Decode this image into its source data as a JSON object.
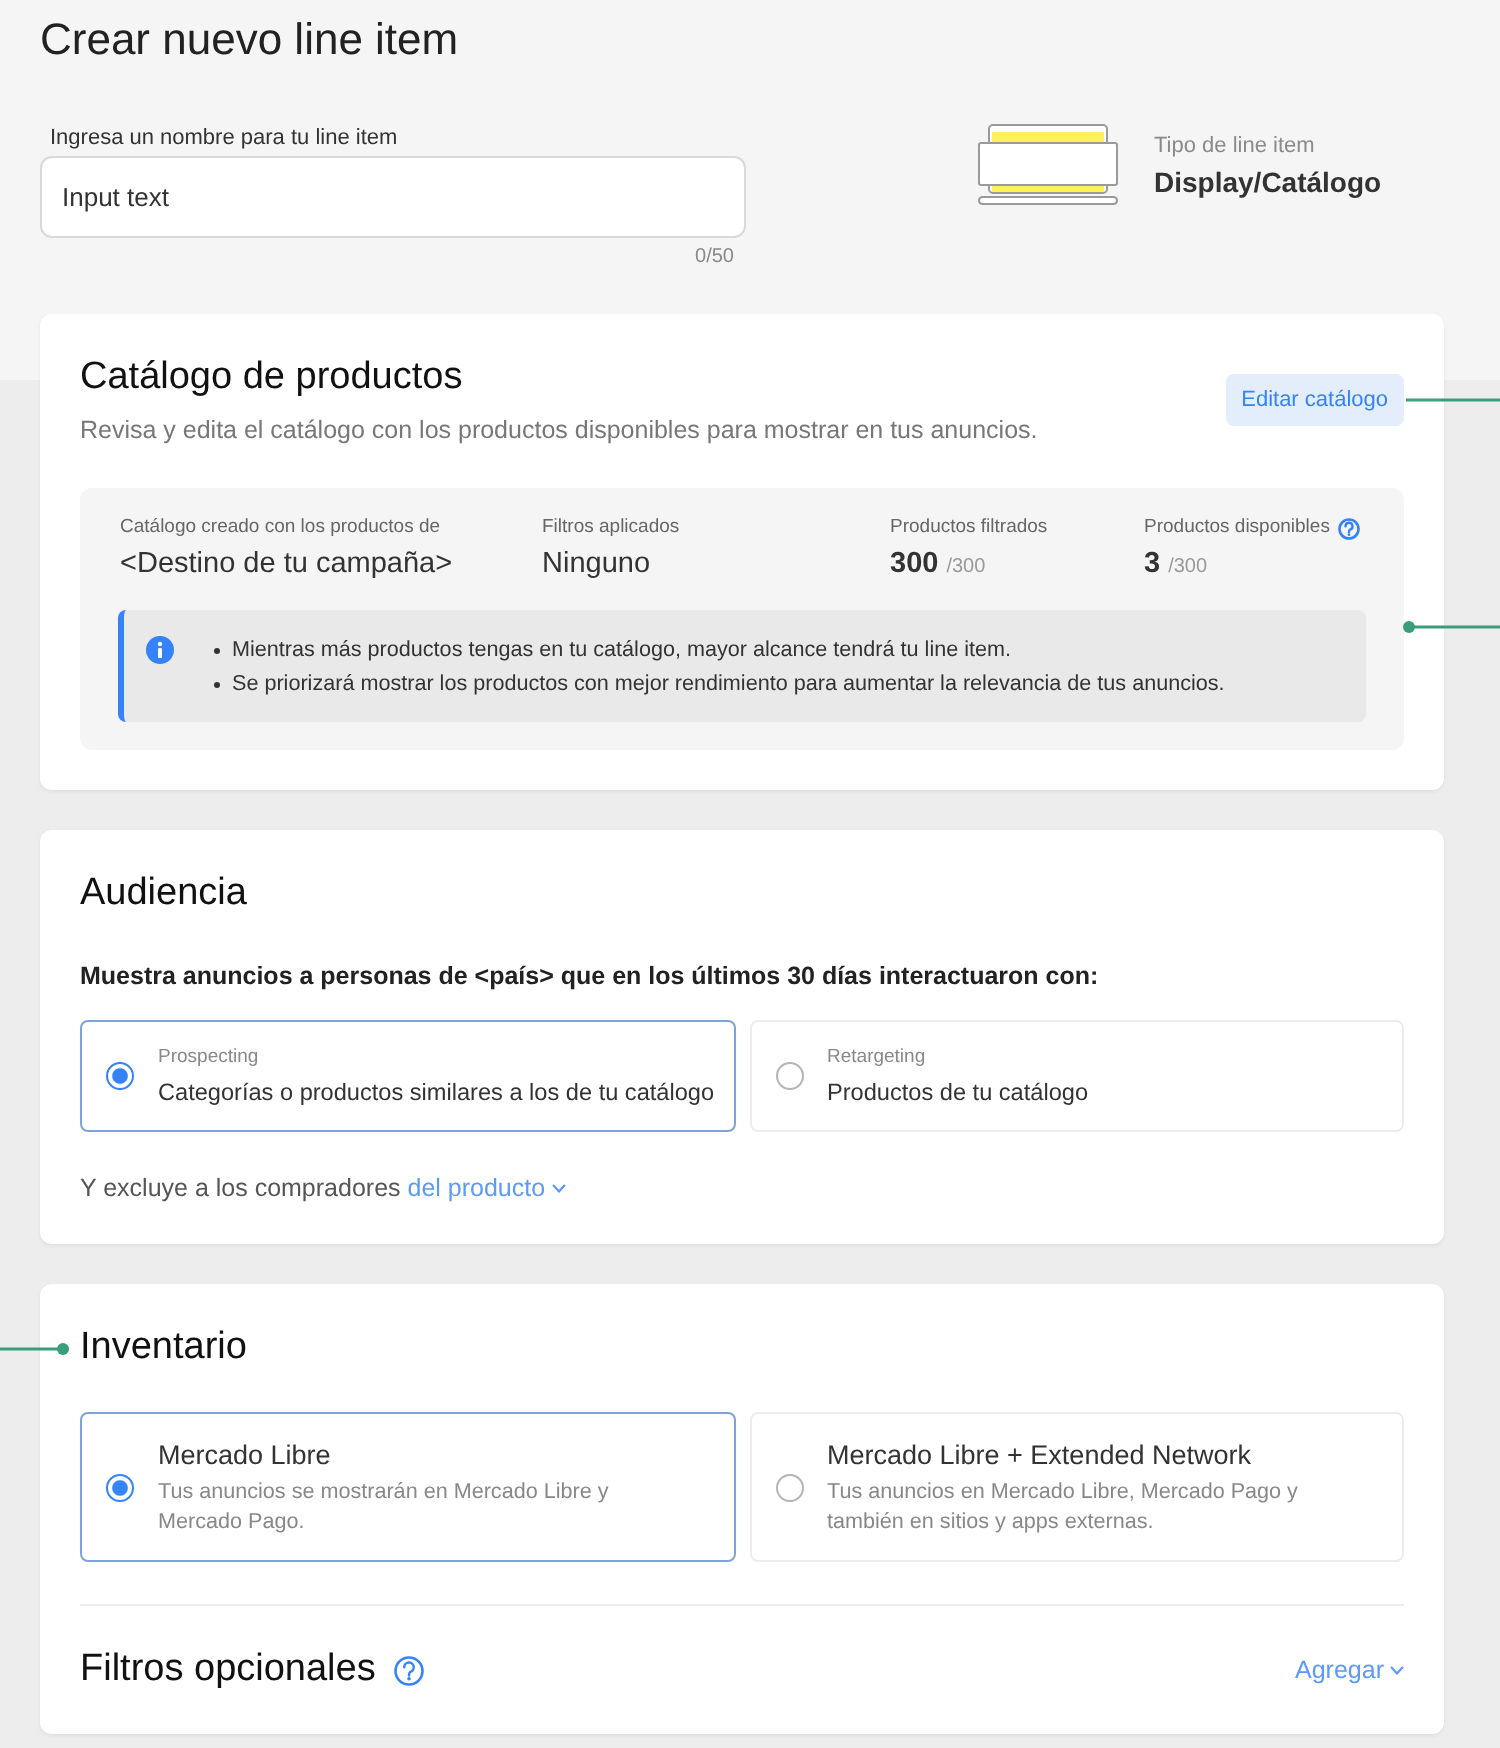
{
  "page": {
    "title": "Crear nuevo line item"
  },
  "name_field": {
    "label": "Ingresa un nombre para tu line item",
    "value": "Input text",
    "counter": "0/50"
  },
  "line_item_type": {
    "label": "Tipo de line item",
    "value": "Display/Catálogo"
  },
  "catalog": {
    "title": "Catálogo de productos",
    "description": "Revisa y edita el catálogo con los productos disponibles para mostrar en tus anuncios.",
    "edit_button": "Editar catálogo",
    "stats": [
      {
        "label": "Catálogo creado con los productos de",
        "value": "<Destino de tu campaña>",
        "kind": "text",
        "help": false
      },
      {
        "label": "Filtros aplicados",
        "value": "Ninguno",
        "kind": "text",
        "help": false
      },
      {
        "label": "Productos filtrados",
        "value": "300",
        "total": "/300",
        "kind": "count",
        "help": false
      },
      {
        "label": "Productos disponibles",
        "value": "3",
        "total": "/300",
        "kind": "count",
        "help": true
      }
    ],
    "info": [
      "Mientras más productos tengas en tu catálogo, mayor alcance tendrá tu line item.",
      "Se priorizará mostrar los productos con mejor rendimiento para aumentar la relevancia de tus anuncios."
    ]
  },
  "audience": {
    "title": "Audiencia",
    "prompt": "Muestra anuncios a personas de <país> que en los últimos 30 días interactuaron con:",
    "options": [
      {
        "label": "Prospecting",
        "description": "Categorías o productos similares a los de tu catálogo",
        "selected": true
      },
      {
        "label": "Retargeting",
        "description": "Productos de tu catálogo",
        "selected": false
      }
    ],
    "exclusion": {
      "text": "Y excluye a los compradores",
      "link": "del producto"
    }
  },
  "inventory": {
    "title": "Inventario",
    "options": [
      {
        "title": "Mercado Libre",
        "description": "Tus anuncios se mostrarán en Mercado Libre y Mercado Pago.",
        "selected": true
      },
      {
        "title": "Mercado Libre + Extended Network",
        "description": "Tus anuncios en Mercado Libre, Mercado Pago y también en sitios y apps externas.",
        "selected": false
      }
    ]
  },
  "optional_filters": {
    "title": "Filtros opcionales",
    "action": "Agregar"
  }
}
